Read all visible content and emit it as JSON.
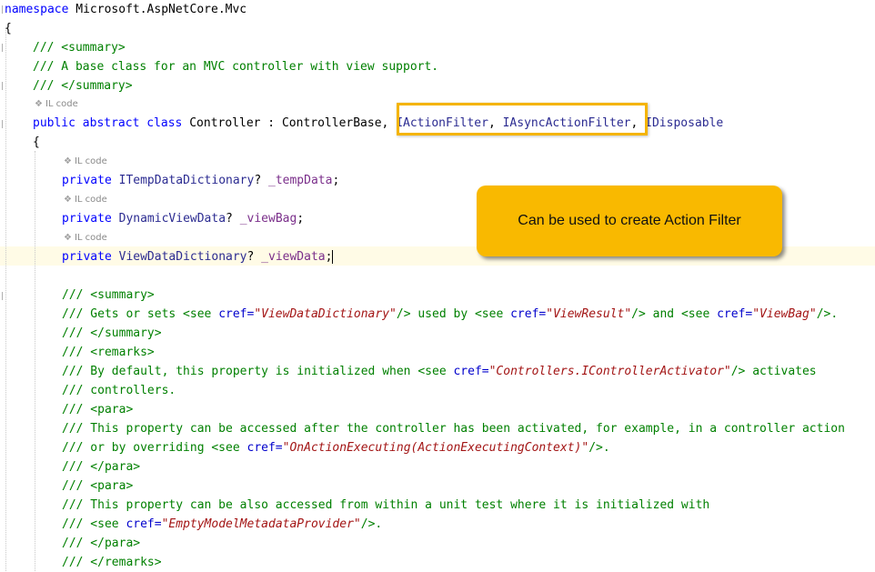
{
  "code": {
    "l1_ns": "namespace",
    "l1_name": " Microsoft.AspNetCore.Mvc",
    "l2": "{",
    "l3": "/// <summary>",
    "l4": "/// A base class for an MVC controller with view support.",
    "l5": "/// </summary>",
    "il_label": "IL code",
    "l7_public": "public",
    "l7_abstract": " abstract",
    "l7_class": " class",
    "l7_name": " Controller : ControllerBase, ",
    "l7_iface1": "IActionFilter",
    "l7_comma": ", ",
    "l7_iface2": "IAsyncActionFilter",
    "l7_sep": ", ",
    "l7_iface3": "IDisposable",
    "l8": "{",
    "f1_private": "private",
    "f1_type": " ITempDataDictionary",
    "f1_rest": "? ",
    "f1_name": "_tempData",
    "f1_end": ";",
    "f2_private": "private",
    "f2_type": " DynamicViewData",
    "f2_rest": "? ",
    "f2_name": "_viewBag",
    "f2_end": ";",
    "f3_private": "private",
    "f3_type": " ViewDataDictionary",
    "f3_rest": "? ",
    "f3_name": "_viewData",
    "f3_end": ";",
    "d1": "/// <summary>",
    "d2_a": "/// Gets or sets <see ",
    "d2_cref1": "cref=",
    "d2_v1": "\"ViewDataDictionary\"",
    "d2_b": "/> used by <see ",
    "d2_cref2": "cref=",
    "d2_v2": "\"ViewResult\"",
    "d2_c": "/> and <see ",
    "d2_cref3": "cref=",
    "d2_v3": "\"ViewBag\"",
    "d2_d": "/>.",
    "d3": "/// </summary>",
    "d4": "/// <remarks>",
    "d5_a": "/// By default, this property is initialized when <see ",
    "d5_cref": "cref=",
    "d5_v": "\"Controllers.IControllerActivator\"",
    "d5_b": "/> activates",
    "d6": "/// controllers.",
    "d7": "/// <para>",
    "d8": "/// This property can be accessed after the controller has been activated, for example, in a controller action",
    "d9_a": "/// or by overriding <see ",
    "d9_cref": "cref=",
    "d9_v": "\"OnActionExecuting(ActionExecutingContext)\"",
    "d9_b": "/>.",
    "d10": "/// </para>",
    "d11": "/// <para>",
    "d12": "/// This property can be also accessed from within a unit test where it is initialized with",
    "d13_a": "/// <see ",
    "d13_cref": "cref=",
    "d13_v": "\"EmptyModelMetadataProvider\"",
    "d13_b": "/>.",
    "d14": "/// </para>",
    "d15": "/// </remarks>"
  },
  "callout": {
    "text": "Can be used to create Action Filter"
  },
  "colors": {
    "highlight": "#f4b400",
    "callout_bg": "#f9b900"
  }
}
